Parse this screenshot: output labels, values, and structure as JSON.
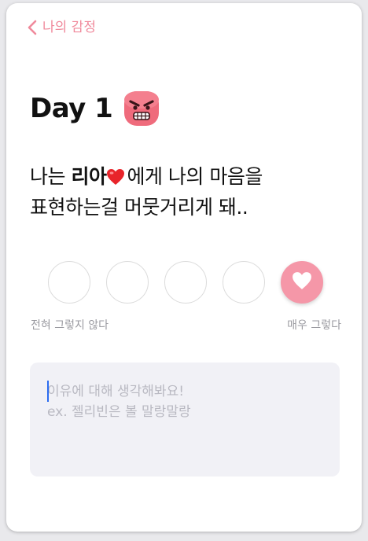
{
  "header": {
    "back_label": "나의 감정",
    "back_icon": "chevron-left-icon"
  },
  "day": {
    "title": "Day 1",
    "emotion_icon": "angry-face-icon"
  },
  "prompt": {
    "before": "나는 ",
    "name": "리아",
    "heart_icon": "red-heart-icon",
    "after": "에게 나의 마음을",
    "line2": "표현하는걸 머뭇거리게 돼.."
  },
  "scale": {
    "option_count": 5,
    "selected_index": 4,
    "selected_icon": "heart-icon",
    "label_low": "전혀 그렇지 않다",
    "label_high": "매우 그렇다"
  },
  "reason": {
    "placeholder": "이유에 대해 생각해봐요!\nex. 젤리빈은 볼 말랑말랑",
    "value": ""
  },
  "colors": {
    "accent": "#f08a9c",
    "selected": "#f597a8",
    "heart": "#e8242a",
    "caret": "#2b6cf0",
    "input_bg": "#f1f1f6"
  }
}
